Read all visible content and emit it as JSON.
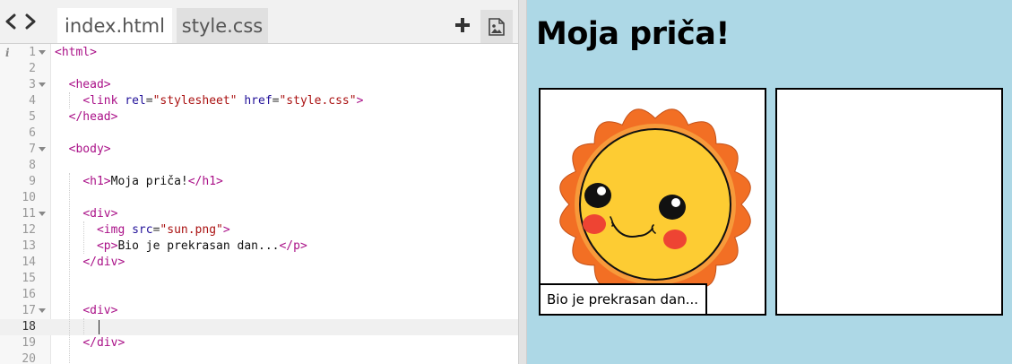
{
  "editor": {
    "tabs": [
      {
        "label": "index.html",
        "active": true
      },
      {
        "label": "style.css",
        "active": false
      }
    ],
    "add_file_icon": "plus-icon",
    "add_image_icon": "image-icon",
    "info_icon": "i",
    "active_line": 18,
    "lines": [
      {
        "n": "1",
        "fold": true,
        "text": "<html>"
      },
      {
        "n": "2",
        "fold": false,
        "text": ""
      },
      {
        "n": "3",
        "fold": true,
        "text": "  <head>"
      },
      {
        "n": "4",
        "fold": false,
        "text": "    <link rel=\"stylesheet\" href=\"style.css\">"
      },
      {
        "n": "5",
        "fold": false,
        "text": "  </head>"
      },
      {
        "n": "6",
        "fold": false,
        "text": ""
      },
      {
        "n": "7",
        "fold": true,
        "text": "  <body>"
      },
      {
        "n": "8",
        "fold": false,
        "text": ""
      },
      {
        "n": "9",
        "fold": false,
        "text": "    <h1>Moja priča!</h1>"
      },
      {
        "n": "10",
        "fold": false,
        "text": ""
      },
      {
        "n": "11",
        "fold": true,
        "text": "    <div>"
      },
      {
        "n": "12",
        "fold": false,
        "text": "      <img src=\"sun.png\">"
      },
      {
        "n": "13",
        "fold": false,
        "text": "      <p>Bio je prekrasan dan...</p>"
      },
      {
        "n": "14",
        "fold": false,
        "text": "    </div>"
      },
      {
        "n": "15",
        "fold": false,
        "text": ""
      },
      {
        "n": "16",
        "fold": false,
        "text": ""
      },
      {
        "n": "17",
        "fold": true,
        "text": "    <div>"
      },
      {
        "n": "18",
        "fold": false,
        "text": ""
      },
      {
        "n": "19",
        "fold": false,
        "text": "    </div>"
      },
      {
        "n": "20",
        "fold": false,
        "text": ""
      }
    ]
  },
  "preview": {
    "title": "Moja priča!",
    "panels": [
      {
        "image": "sun",
        "caption": "Bio je prekrasan dan..."
      },
      {
        "image": "",
        "caption": ""
      }
    ],
    "background_color": "#add8e6"
  },
  "colors": {
    "tag": "#aa1188",
    "attribute": "#221199",
    "string": "#aa1111",
    "sun_rays": "#f26f24",
    "sun_face": "#fdcc33",
    "cheeks": "#ee4433"
  }
}
